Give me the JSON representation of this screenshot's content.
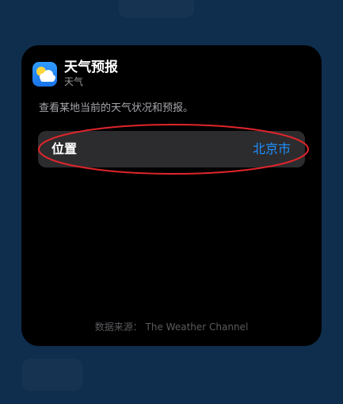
{
  "widget": {
    "title": "天气预报",
    "subtitle": "天气",
    "description": "查看某地当前的天气状况和预报。",
    "location_row": {
      "label": "位置",
      "value": "北京市"
    },
    "footer": "数据来源： The Weather Channel"
  },
  "icons": {
    "app_icon": "weather-sun-cloud-icon"
  },
  "colors": {
    "background": "#0f2e4d",
    "card": "#000000",
    "row": "#2c2c2e",
    "accent": "#1e90ff",
    "annotation": "#e0252b"
  }
}
